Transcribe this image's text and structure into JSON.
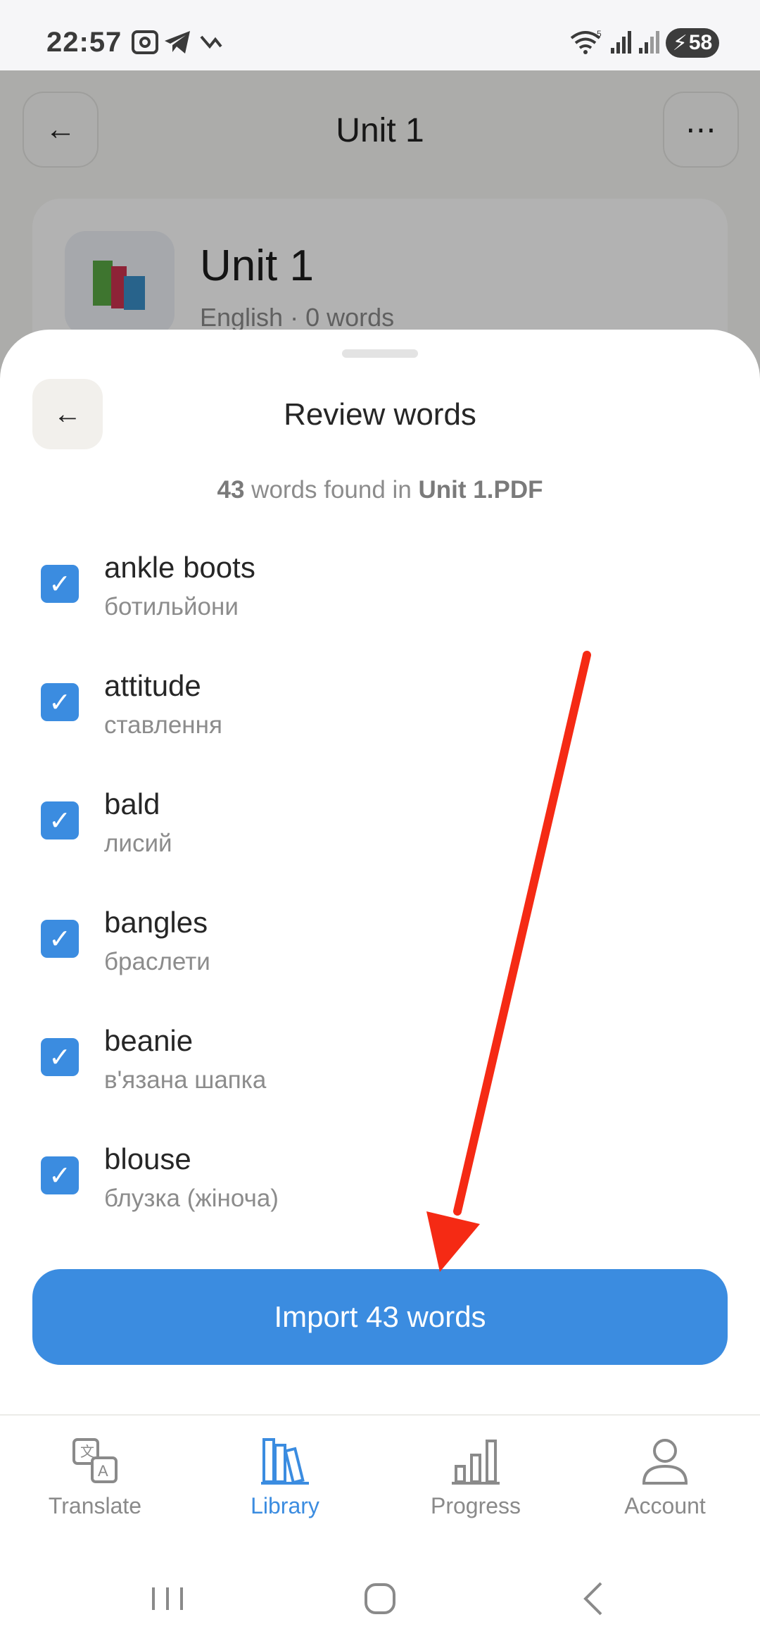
{
  "status_bar": {
    "time": "22:57",
    "battery": "58",
    "icons": [
      "screenshot-icon",
      "telegram-icon",
      "missed-call-icon",
      "wifi-icon",
      "signal-icon",
      "signal-icon-2"
    ]
  },
  "background": {
    "title": "Unit 1",
    "card": {
      "name": "Unit 1",
      "subtitle": "English · 0 words"
    }
  },
  "sheet": {
    "title": "Review words",
    "count": "43",
    "found_text": " words found in ",
    "file_name": "Unit 1.PDF",
    "words": [
      {
        "word": "ankle boots",
        "translation": "ботильйони",
        "checked": true
      },
      {
        "word": "attitude",
        "translation": "ставлення",
        "checked": true
      },
      {
        "word": "bald",
        "translation": "лисий",
        "checked": true
      },
      {
        "word": "bangles",
        "translation": "браслети",
        "checked": true
      },
      {
        "word": "beanie",
        "translation": "в'язана шапка",
        "checked": true
      },
      {
        "word": "blouse",
        "translation": "блузка (жіноча)",
        "checked": true
      }
    ],
    "import_label": "Import 43 words"
  },
  "tabs": [
    {
      "label": "Translate",
      "icon": "translate-icon",
      "active": false
    },
    {
      "label": "Library",
      "icon": "library-icon",
      "active": true
    },
    {
      "label": "Progress",
      "icon": "progress-icon",
      "active": false
    },
    {
      "label": "Account",
      "icon": "account-icon",
      "active": false
    }
  ],
  "colors": {
    "accent": "#3b8ce0",
    "annotation_arrow": "#f52a14"
  }
}
